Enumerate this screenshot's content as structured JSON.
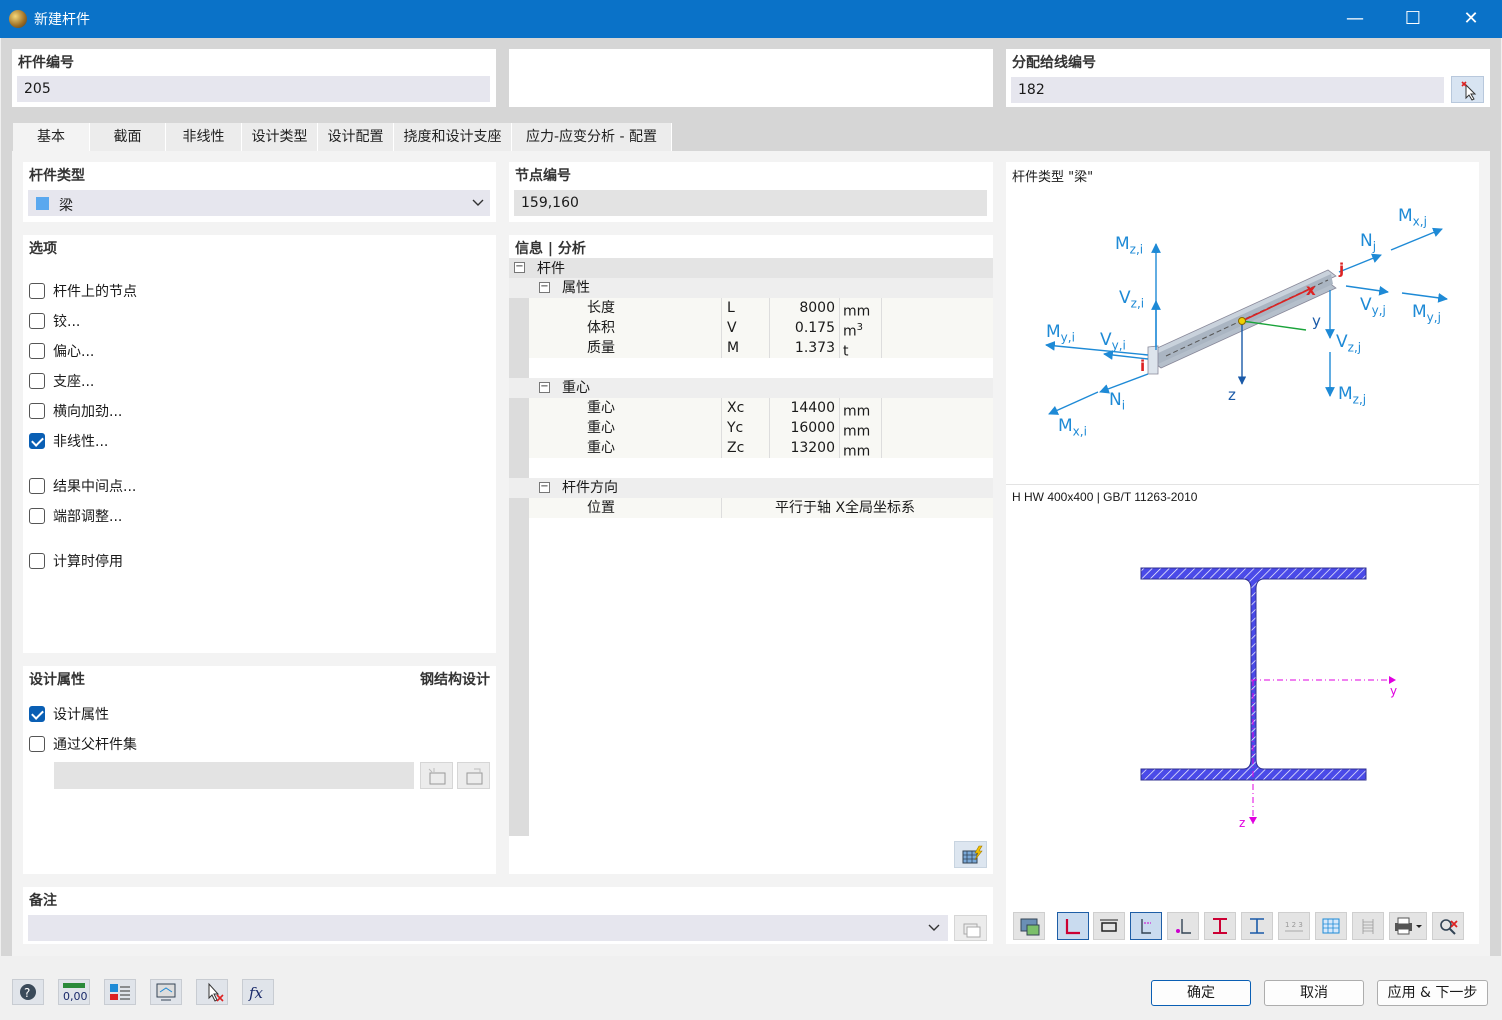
{
  "window": {
    "title": "新建杆件"
  },
  "header": {
    "member_no_label": "杆件编号",
    "member_no_value": "205",
    "line_label": "分配给线编号",
    "line_value": "182"
  },
  "tabs": [
    "基本",
    "截面",
    "非线性",
    "设计类型",
    "设计配置",
    "挠度和设计支座",
    "应力-应变分析 - 配置"
  ],
  "left": {
    "member_type_label": "杆件类型",
    "member_type_value": "梁",
    "options_label": "选项",
    "options": [
      {
        "label": "杆件上的节点",
        "checked": false
      },
      {
        "label": "铰...",
        "checked": false
      },
      {
        "label": "偏心...",
        "checked": false
      },
      {
        "label": "支座...",
        "checked": false
      },
      {
        "label": "横向加劲...",
        "checked": false
      },
      {
        "label": "非线性...",
        "checked": true
      },
      {
        "label": "结果中间点...",
        "checked": false
      },
      {
        "label": "端部调整...",
        "checked": false
      },
      {
        "label": "计算时停用",
        "checked": false
      }
    ],
    "design_label": "设计属性",
    "design_right": "钢结构设计",
    "design_options": [
      {
        "label": "设计属性",
        "checked": true
      },
      {
        "label": "通过父杆件集",
        "checked": false
      }
    ]
  },
  "middle": {
    "nodes_label": "节点编号",
    "nodes_value": "159,160",
    "info_label": "信息 | 分析",
    "tree": {
      "root": "杆件",
      "g1": "属性",
      "rows1": [
        {
          "name": "长度",
          "sym": "L",
          "val": "8000",
          "unit": "mm"
        },
        {
          "name": "体积",
          "sym": "V",
          "val": "0.175",
          "unit": "m",
          "sup": "3"
        },
        {
          "name": "质量",
          "sym": "M",
          "val": "1.373",
          "unit": "t"
        }
      ],
      "g2": "重心",
      "rows2": [
        {
          "name": "重心",
          "sym": "Xc",
          "val": "14400",
          "unit": "mm"
        },
        {
          "name": "重心",
          "sym": "Yc",
          "val": "16000",
          "unit": "mm"
        },
        {
          "name": "重心",
          "sym": "Zc",
          "val": "13200",
          "unit": "mm"
        }
      ],
      "g3": "杆件方向",
      "rows3": [
        {
          "name": "位置",
          "val": "平行于轴 X全局坐标系"
        }
      ]
    }
  },
  "right": {
    "type_title": "杆件类型 \"梁\"",
    "labels": {
      "mxj": "M",
      "mxj_sub": "x,j",
      "nj": "N",
      "nj_sub": "j",
      "mzi": "M",
      "mzi_sub": "z,i",
      "vzi": "V",
      "vzi_sub": "z,i",
      "j": "j",
      "x": "x",
      "vyj": "V",
      "vyj_sub": "y,j",
      "myj": "M",
      "myj_sub": "y,j",
      "myi": "M",
      "myi_sub": "y,i",
      "vyi": "V",
      "vyi_sub": "y,i",
      "y": "y",
      "vzj": "V",
      "vzj_sub": "z,j",
      "i": "i",
      "z": "z",
      "ni": "N",
      "ni_sub": "i",
      "mzj": "M",
      "mzj_sub": "z,j",
      "mxi": "M",
      "mxi_sub": "x,i"
    },
    "section_title": "H HW 400x400 | GB/T 11263-2010",
    "sec_y": "y",
    "sec_z": "z"
  },
  "notes": {
    "label": "备注"
  },
  "footer": {
    "ok": "确定",
    "cancel": "取消",
    "apply_next": "应用 & 下一步",
    "num_icon": "0,00"
  },
  "colors": {
    "accent": "#0a72c8",
    "blue_arrow": "#1e8ad6",
    "section_fill": "#4a4ae8"
  }
}
